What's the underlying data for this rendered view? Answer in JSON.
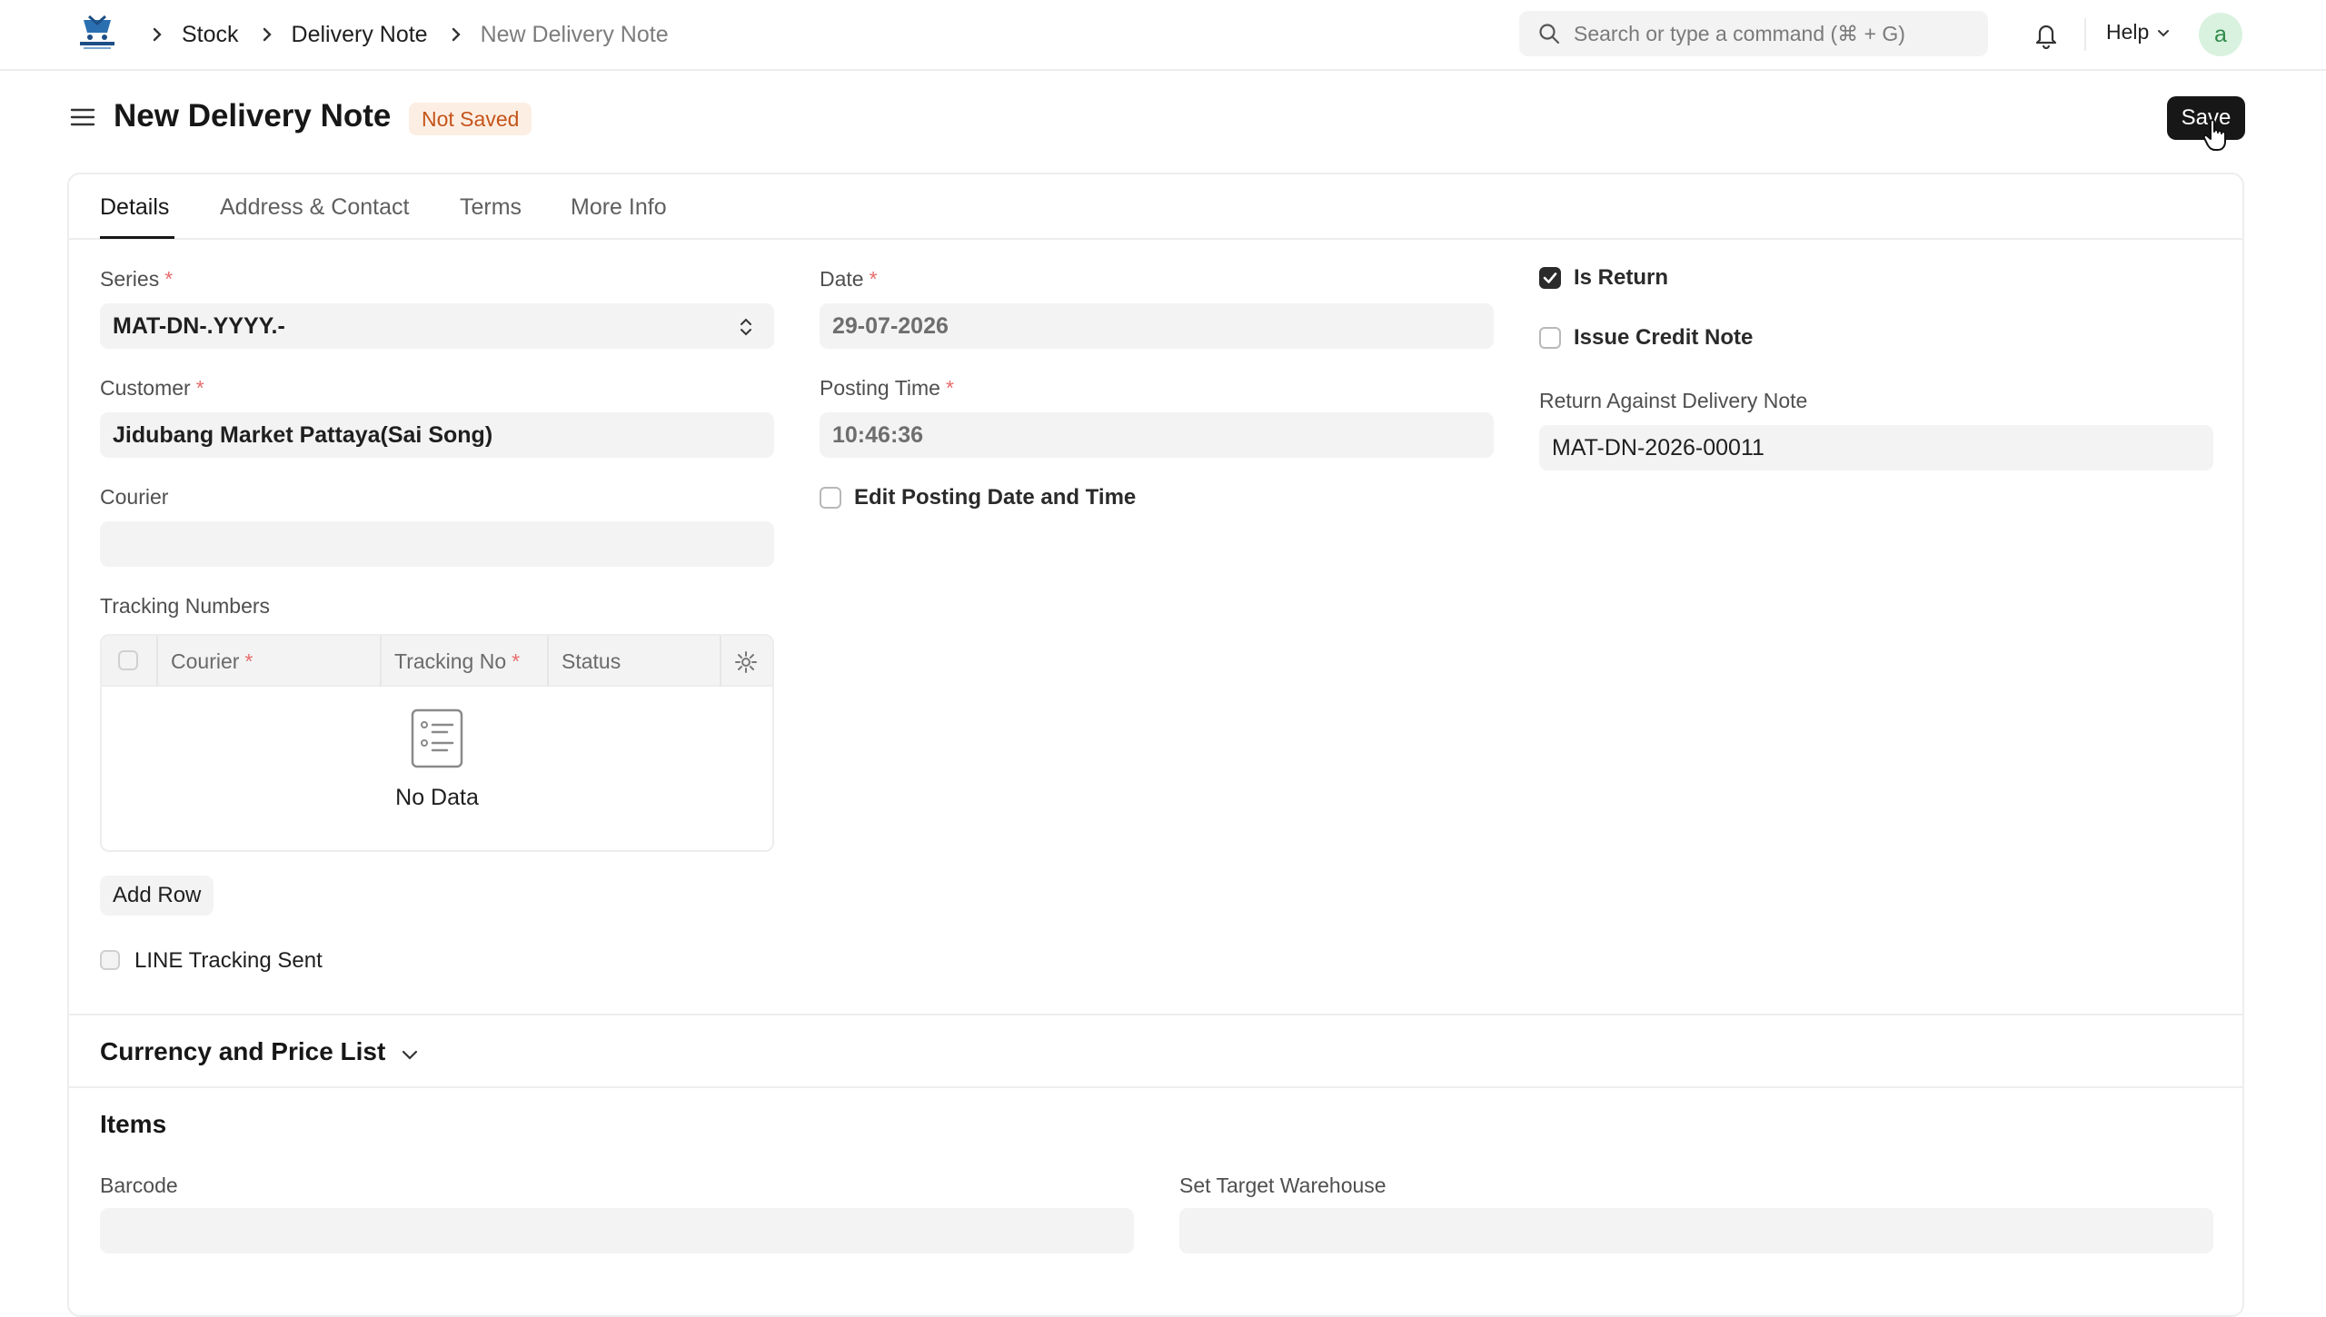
{
  "navbar": {
    "breadcrumbs": [
      "Stock",
      "Delivery Note",
      "New Delivery Note"
    ],
    "search_placeholder": "Search or type a command (⌘ + G)",
    "help_label": "Help",
    "avatar_letter": "a"
  },
  "page": {
    "title": "New Delivery Note",
    "status_badge": "Not Saved",
    "save_label": "Save"
  },
  "tabs": [
    "Details",
    "Address & Contact",
    "Terms",
    "More Info"
  ],
  "form": {
    "series_label": "Series",
    "series_value": "MAT-DN-.YYYY.-",
    "customer_label": "Customer",
    "customer_value": "Jidubang Market Pattaya(Sai Song)",
    "courier_label": "Courier",
    "courier_value": "",
    "tracking_label": "Tracking Numbers",
    "date_label": "Date",
    "date_value": "29-07-2026",
    "posting_time_label": "Posting Time",
    "posting_time_value": "10:46:36",
    "edit_posting_label": "Edit Posting Date and Time",
    "is_return_label": "Is Return",
    "is_return_checked": true,
    "issue_credit_label": "Issue Credit Note",
    "return_against_label": "Return Against Delivery Note",
    "return_against_value": "MAT-DN-2026-00011",
    "line_tracking_label": "LINE Tracking Sent"
  },
  "tracking_table": {
    "columns": [
      "Courier",
      "Tracking No",
      "Status"
    ],
    "empty_text": "No Data",
    "add_row_label": "Add Row"
  },
  "sections": {
    "currency_title": "Currency and Price List",
    "items_title": "Items",
    "barcode_label": "Barcode",
    "target_warehouse_label": "Set Target Warehouse"
  },
  "colors": {
    "accent": "#171717",
    "badge_bg": "#fdeee3",
    "badge_text": "#c4541a",
    "required": "#e86c6c",
    "field_bg": "#f3f3f3"
  }
}
